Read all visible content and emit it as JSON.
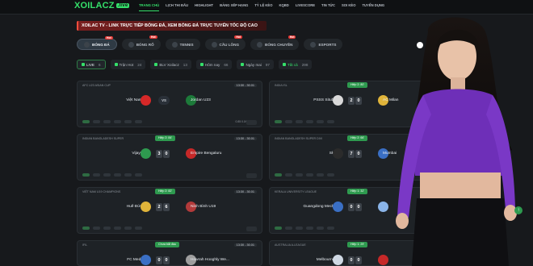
{
  "brand": {
    "logo_text": "XOILACZ",
    "logo_suffix": ".live"
  },
  "nav": [
    {
      "label": "TRANG CHỦ",
      "active": true
    },
    {
      "label": "LỊCH THI ĐẤU",
      "active": false
    },
    {
      "label": "HIGHLIGHT",
      "active": false
    },
    {
      "label": "BẢNG XẾP HẠNG",
      "active": false
    },
    {
      "label": "TỶ LỆ KÈO",
      "active": false
    },
    {
      "label": "KQBD",
      "active": false
    },
    {
      "label": "LIVESCORE",
      "active": false
    },
    {
      "label": "TIN TỨC",
      "active": false
    },
    {
      "label": "SOI KÈO",
      "active": false
    },
    {
      "label": "TUYỂN DỤNG",
      "active": false
    }
  ],
  "banner": {
    "text": "XOILAC TV - LINK TRỰC TIẾP BÓNG ĐÁ, XEM BÓNG ĐÁ TRỰC TUYẾN TỐC ĐỘ CAO"
  },
  "sport_tabs": [
    {
      "label": "BÓNG ĐÁ",
      "badge": "Hot",
      "active": true
    },
    {
      "label": "BÓNG RỔ",
      "badge": "Hot",
      "active": false
    },
    {
      "label": "TENNIS",
      "badge": "",
      "active": false
    },
    {
      "label": "CẦU LÔNG",
      "badge": "Hot",
      "active": false
    },
    {
      "label": "BÓNG CHUYỀN",
      "badge": "Hot",
      "active": false
    },
    {
      "label": "ESPORTS",
      "badge": "",
      "active": false
    }
  ],
  "filters": [
    {
      "label": "LIVE",
      "count": "6",
      "variant": "live"
    },
    {
      "label": "Trận Hot",
      "count": "24",
      "variant": ""
    },
    {
      "label": "BLV Xoilacz",
      "count": "13",
      "variant": ""
    },
    {
      "label": "Hôm nay",
      "count": "66",
      "variant": ""
    },
    {
      "label": "Ngày mai",
      "count": "97",
      "variant": ""
    },
    {
      "label": "Tất cả",
      "count": "298",
      "variant": "highlight"
    }
  ],
  "matches": [
    {
      "league": "AFC U23 ASIAN CUP",
      "time": "13:30 - 30.01",
      "status": "",
      "home": "Việt Nam U23",
      "away": "Jordan U23",
      "home_color": "#d62828",
      "away_color": "#1d7a3a",
      "score_home": "",
      "score_away": "",
      "vs": "VS",
      "odds": "0.85   0.0/0.5   0.95",
      "blv": "BLV"
    },
    {
      "league": "INDIA ISL",
      "time": "13:30 - 30.01",
      "status": "Hiệp 2: 80'",
      "home": "PSSS Situbondo",
      "away": "AC Milan",
      "home_color": "#d9d9d9",
      "away_color": "#e0b43a",
      "score_home": "2",
      "score_away": "0",
      "vs": "",
      "odds": "",
      "blv": ""
    },
    {
      "league": "INDIAN BANGLADESH SUPER",
      "time": "13:30 - 30.01",
      "status": "Hiệp 2: 84'",
      "home": "Vijaynagar",
      "away": "Empire Bengaluru",
      "home_color": "#2e9a4f",
      "away_color": "#c62828",
      "score_home": "3",
      "score_away": "0",
      "vs": "",
      "odds": "",
      "blv": ""
    },
    {
      "league": "INDIAN BANGLADESH SUPER DIVI",
      "time": "13:30 - 30.01",
      "status": "Hiệp 2: 66'",
      "home": "Skorzet",
      "away": "Mumbai",
      "home_color": "#2b2b2b",
      "away_color": "#3a6fc4",
      "score_home": "7",
      "score_away": "0",
      "vs": "",
      "odds": "",
      "blv": ""
    },
    {
      "league": "VIỆT NAM U19 CHAMPIONS",
      "time": "13:30 - 30.01",
      "status": "Hiệp 2: 82'",
      "home": "Huế Đức U19",
      "away": "Ninh Bình U19",
      "home_color": "#e0b43a",
      "away_color": "#b23a3a",
      "score_home": "2",
      "score_away": "6",
      "vs": "",
      "odds": "",
      "blv": ""
    },
    {
      "league": "KERALA UNIVERSITY LEAGUE",
      "time": "13:30 - 30.01",
      "status": "Hiệp 1: 32'",
      "home": "Guangdong Mechani...",
      "away": "",
      "home_color": "#3a6fc4",
      "away_color": "#8ab4e8",
      "score_home": "0",
      "score_away": "0",
      "vs": "",
      "odds": "",
      "blv": ""
    },
    {
      "league": "IFIL",
      "time": "13:30 - 30.01",
      "status": "Chưa bắt đầu",
      "home": "FC Medinipur",
      "away": "Howrah Hooghly We...",
      "home_color": "#3a6fc4",
      "away_color": "#9e9e9e",
      "score_home": "0",
      "score_away": "0",
      "vs": "",
      "odds": "",
      "blv": ""
    },
    {
      "league": "AUSTRALIA A-LEAGUE",
      "time": "13:30 - 30.01",
      "status": "Hiệp 1: 29'",
      "home": "Melbourne City",
      "away": "",
      "home_color": "#cfd8e3",
      "away_color": "#c62828",
      "score_home": "0",
      "score_away": "0",
      "vs": "",
      "odds": "",
      "blv": ""
    }
  ],
  "colors": {
    "accent": "#35e06a",
    "background": "#17191c",
    "card": "#1e2226",
    "banner": "#7a1f1f",
    "live_tag": "#2e9a4f"
  }
}
